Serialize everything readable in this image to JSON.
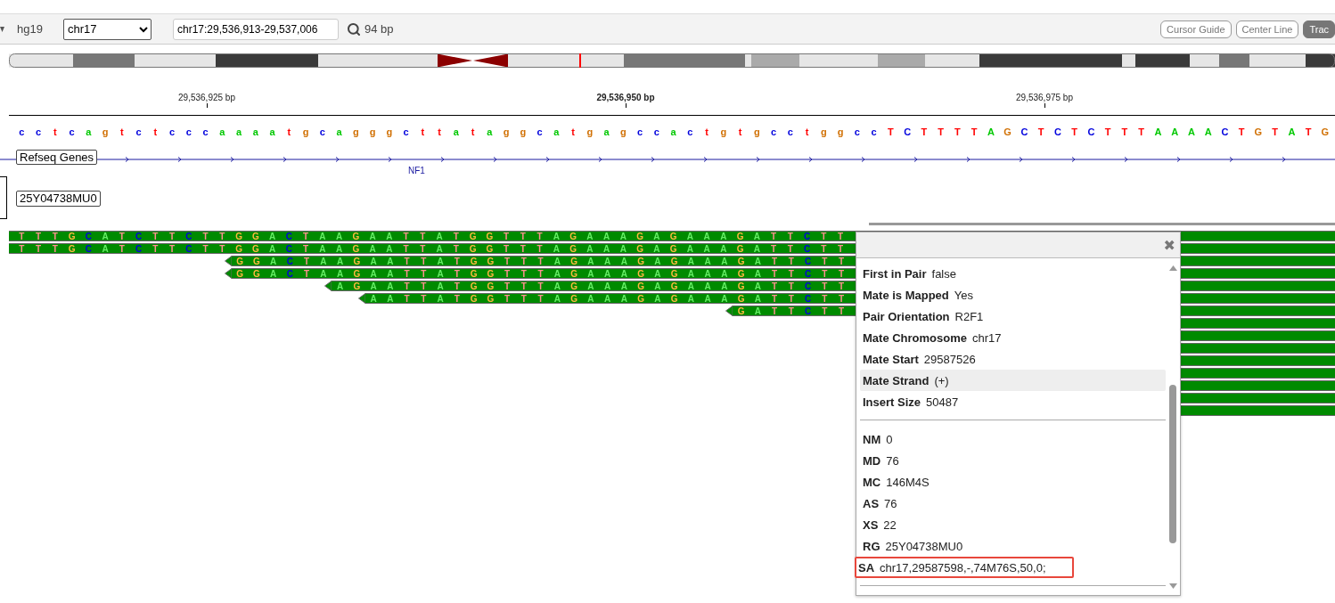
{
  "toolbar": {
    "genome": "hg19",
    "chromosome": "chr17",
    "locus": "chr17:29,536,913-29,537,006",
    "width_label": "94 bp",
    "buttons": [
      {
        "label": "Cursor Guide",
        "selected": false
      },
      {
        "label": "Center Line",
        "selected": false
      },
      {
        "label": "Trac",
        "selected": true
      }
    ]
  },
  "ruler": {
    "ticks": [
      {
        "label": "29,536,925 bp",
        "center": false
      },
      {
        "label": "29,536,950 bp",
        "center": true
      },
      {
        "label": "29,536,975 bp",
        "center": false
      }
    ]
  },
  "sequence": "c c t c a g t c t c c c a a a a t g c a g g g c t t a t a g g c a t g a g c c a c t g t g c c t g g c c T C T T T T A G C T C T C T T T A A A A C T G T A T G",
  "gene_track": {
    "label": "Refseq Genes",
    "gene": "NF1"
  },
  "sample_label": "25Y04738MU0",
  "reads": [
    {
      "bases": "T T T G C A T C T T C T T G G A C T A A G A A T T A T G G T T T A G A A A G A G A A A G A T T C T T",
      "kind": "forward"
    },
    {
      "bases": "T T T G C A T C T T C T T G G A C T A A G A A T T A T G G T T T A G A A A G A G A A A G A T T C T T",
      "kind": "forward"
    },
    {
      "bases": "G G A C T A A G A A T T A T G G T T T A G A A A G A G A A A G A T T C T T",
      "kind": "reverse"
    },
    {
      "bases": "G G A C T A A G A A T T A T G G T T T A G A A A G A G A A A G A T T C T T",
      "kind": "reverse"
    },
    {
      "bases": "A G A A T T A T G G T T T A G A A A G A G A A A G A T T C T T",
      "kind": "reverse"
    },
    {
      "bases": "A A T T A T G G T T T A G A A A G A G A A A G A T T C T T",
      "kind": "reverse"
    },
    {
      "bases": "G A T T C T T",
      "kind": "reverse"
    },
    {
      "kind": "hidden"
    },
    {
      "kind": "hidden"
    },
    {
      "kind": "hidden"
    },
    {
      "kind": "hidden"
    },
    {
      "kind": "hidden"
    },
    {
      "kind": "hidden"
    },
    {
      "kind": "hidden"
    },
    {
      "kind": "hidden"
    }
  ],
  "popup": {
    "close": "✖",
    "sections": [
      {
        "rows": [
          {
            "name": "First in Pair",
            "value": "false",
            "highlighted": false,
            "outlined": false
          },
          {
            "name": "Mate is Mapped",
            "value": "Yes",
            "highlighted": false,
            "outlined": false
          },
          {
            "name": "Pair Orientation",
            "value": "R2F1",
            "highlighted": false,
            "outlined": false
          },
          {
            "name": "Mate Chromosome",
            "value": "chr17",
            "highlighted": false,
            "outlined": false
          },
          {
            "name": "Mate Start",
            "value": "29587526",
            "highlighted": false,
            "outlined": false
          },
          {
            "name": "Mate Strand",
            "value": "(+)",
            "highlighted": true,
            "outlined": false
          },
          {
            "name": "Insert Size",
            "value": "50487",
            "highlighted": false,
            "outlined": false
          }
        ]
      },
      {
        "rows": [
          {
            "name": "NM",
            "value": "0",
            "highlighted": false,
            "outlined": false
          },
          {
            "name": "MD",
            "value": "76",
            "highlighted": false,
            "outlined": false
          },
          {
            "name": "MC",
            "value": "146M4S",
            "highlighted": false,
            "outlined": false
          },
          {
            "name": "AS",
            "value": "76",
            "highlighted": false,
            "outlined": false
          },
          {
            "name": "XS",
            "value": "22",
            "highlighted": false,
            "outlined": false
          },
          {
            "name": "RG",
            "value": "25Y04738MU0",
            "highlighted": false,
            "outlined": false
          },
          {
            "name": "SA",
            "value": "chr17,29587598,-,74M76S,50,0;",
            "highlighted": false,
            "outlined": true
          }
        ]
      }
    ]
  }
}
